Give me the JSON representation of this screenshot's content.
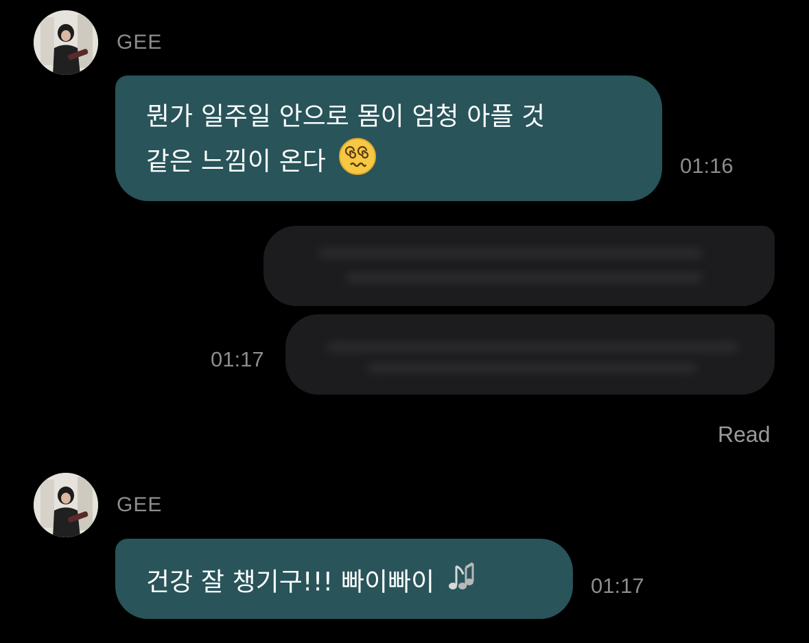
{
  "messages": [
    {
      "sender": "GEE",
      "text_line1": "뭔가 일주일 안으로 몸이 엄청 아플 것",
      "text_line2": "같은 느낌이 온다",
      "emoji": "dizzy-face-icon",
      "time": "01:16"
    },
    {
      "time": "01:17",
      "status": "Read"
    },
    {
      "sender": "GEE",
      "text": "건강 잘 챙기구!!! 빠이빠이",
      "emoji": "musical-notes-icon",
      "time": "01:17"
    }
  ],
  "colors": {
    "background": "#000000",
    "incoming_bubble": "#28545a",
    "outgoing_bubble": "#1c1c1e",
    "secondary_text": "#8e8e8e"
  }
}
